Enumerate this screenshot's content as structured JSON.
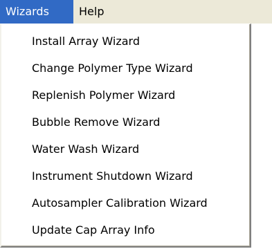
{
  "menubar": {
    "items": [
      {
        "label": "Wizards",
        "active": true
      },
      {
        "label": "Help",
        "active": false
      }
    ]
  },
  "wizards_menu": {
    "items": [
      {
        "label": "Install Array Wizard"
      },
      {
        "label": "Change Polymer Type Wizard"
      },
      {
        "label": "Replenish Polymer Wizard"
      },
      {
        "label": "Bubble Remove Wizard"
      },
      {
        "label": "Water Wash Wizard"
      },
      {
        "label": "Instrument Shutdown Wizard"
      },
      {
        "label": "Autosampler Calibration Wizard"
      },
      {
        "label": "Update Cap Array Info"
      }
    ]
  },
  "colors": {
    "menubar_background": "#ece9d8",
    "selection_background": "#316ac5",
    "selection_text": "#ffffff",
    "menu_background": "#ffffff"
  }
}
